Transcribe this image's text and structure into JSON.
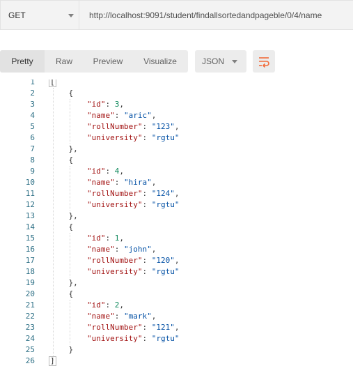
{
  "request": {
    "method": "GET",
    "url": "http://localhost:9091/student/findallsortedandpageble/0/4/name"
  },
  "response_toolbar": {
    "tabs": [
      "Pretty",
      "Raw",
      "Preview",
      "Visualize"
    ],
    "active_tab": "Pretty",
    "format": "JSON",
    "wrap_icon": "wrap-lines-icon",
    "accent_color": "#f26b3a"
  },
  "code": {
    "first_line": "[",
    "last_line": "]",
    "line_numbers": [
      "1",
      "2",
      "3",
      "4",
      "5",
      "6",
      "7",
      "8",
      "9",
      "10",
      "11",
      "12",
      "13",
      "14",
      "15",
      "16",
      "17",
      "18",
      "19",
      "20",
      "21",
      "22",
      "23",
      "24",
      "25",
      "26"
    ],
    "records": [
      {
        "id": "3",
        "name": "\"aric\"",
        "rollNumber": "\"123\"",
        "university": "\"rgtu\""
      },
      {
        "id": "4",
        "name": "\"hira\"",
        "rollNumber": "\"124\"",
        "university": "\"rgtu\""
      },
      {
        "id": "1",
        "name": "\"john\"",
        "rollNumber": "\"120\"",
        "university": "\"rgtu\""
      },
      {
        "id": "2",
        "name": "\"mark\"",
        "rollNumber": "\"121\"",
        "university": "\"rgtu\""
      }
    ],
    "keys": {
      "id": "\"id\"",
      "name": "\"name\"",
      "rollNumber": "\"rollNumber\"",
      "university": "\"university\""
    }
  }
}
